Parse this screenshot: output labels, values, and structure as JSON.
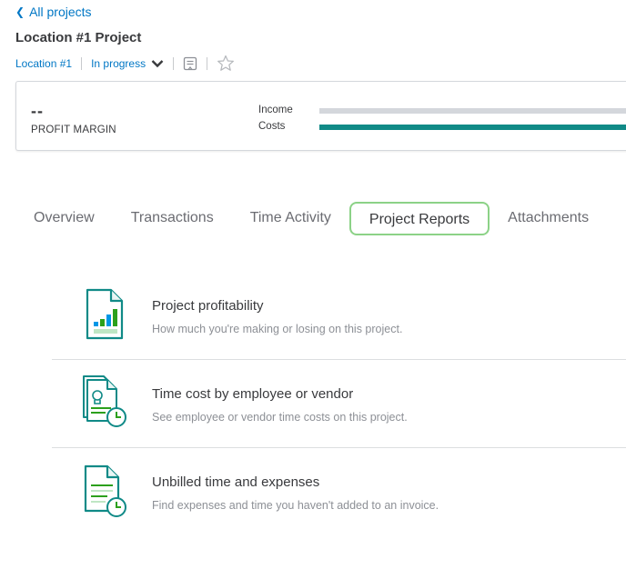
{
  "header": {
    "back_label": "All projects",
    "project_title": "Location #1 Project",
    "customer": "Location #1",
    "status": "In progress"
  },
  "summary": {
    "profit_margin_value": "--",
    "profit_margin_label": "PROFIT MARGIN",
    "income_label": "Income",
    "costs_label": "Costs"
  },
  "tabs": [
    {
      "label": "Overview",
      "active": false
    },
    {
      "label": "Transactions",
      "active": false
    },
    {
      "label": "Time Activity",
      "active": false
    },
    {
      "label": "Project Reports",
      "active": true
    },
    {
      "label": "Attachments",
      "active": false
    }
  ],
  "reports": [
    {
      "title": "Project profitability",
      "description": "How much you're making or losing on this project.",
      "icon": "profitability-report-icon"
    },
    {
      "title": "Time cost by employee or vendor",
      "description": "See employee or vendor time costs on this project.",
      "icon": "time-cost-report-icon"
    },
    {
      "title": "Unbilled time and expenses",
      "description": "Find expenses and time you haven't added to an invoice.",
      "icon": "unbilled-report-icon"
    }
  ],
  "colors": {
    "link": "#0077c5",
    "costs_bar": "#108a87",
    "income_bar": "#d4d7dc",
    "active_tab_border": "#8cd287",
    "icon_teal": "#108a87",
    "icon_green": "#2ca01c",
    "icon_blue": "#0097e6"
  }
}
